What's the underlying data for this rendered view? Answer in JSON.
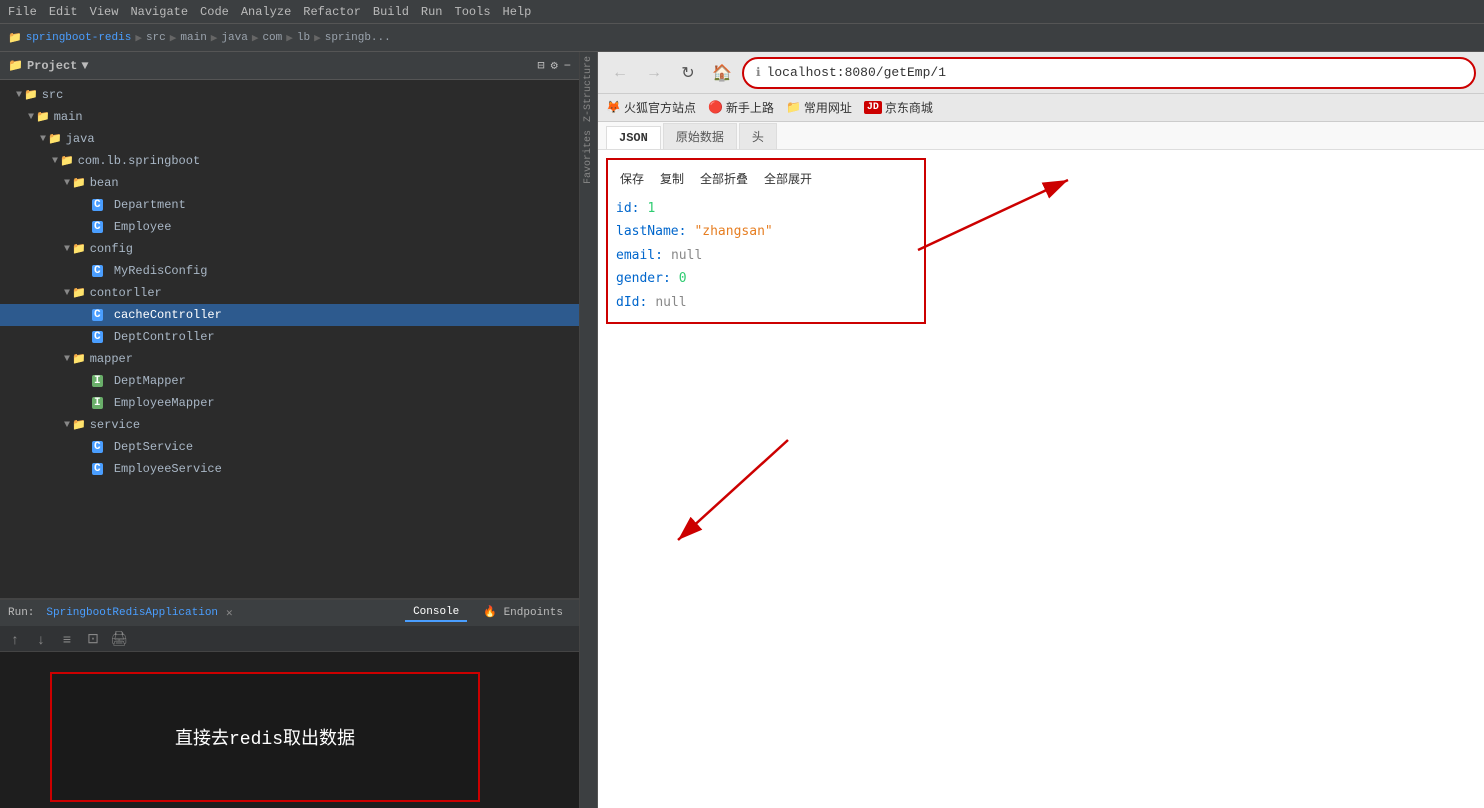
{
  "menubar": {
    "items": [
      "File",
      "Edit",
      "View",
      "Navigate",
      "Code",
      "Analyze",
      "Refactor",
      "Build",
      "Run",
      "Tools",
      "Help"
    ]
  },
  "toolbar": {
    "project_name": "springboot-redis",
    "breadcrumb": [
      "src",
      "main",
      "java",
      "com",
      "lb",
      "springb..."
    ]
  },
  "project_panel": {
    "title": "Project",
    "root": "src",
    "tree": [
      {
        "label": "src",
        "type": "folder",
        "indent": 0,
        "expanded": true
      },
      {
        "label": "main",
        "type": "folder",
        "indent": 1,
        "expanded": true
      },
      {
        "label": "java",
        "type": "folder",
        "indent": 2,
        "expanded": true
      },
      {
        "label": "com.lb.springboot",
        "type": "folder",
        "indent": 3,
        "expanded": true
      },
      {
        "label": "bean",
        "type": "folder",
        "indent": 4,
        "expanded": true
      },
      {
        "label": "Department",
        "type": "class",
        "indent": 5
      },
      {
        "label": "Employee",
        "type": "class",
        "indent": 5
      },
      {
        "label": "config",
        "type": "folder",
        "indent": 4,
        "expanded": true
      },
      {
        "label": "MyRedisConfig",
        "type": "class",
        "indent": 5
      },
      {
        "label": "contorller",
        "type": "folder",
        "indent": 4,
        "expanded": true
      },
      {
        "label": "cacheController",
        "type": "class",
        "indent": 5,
        "selected": true
      },
      {
        "label": "DeptController",
        "type": "class",
        "indent": 5
      },
      {
        "label": "mapper",
        "type": "folder",
        "indent": 4,
        "expanded": true
      },
      {
        "label": "DeptMapper",
        "type": "interface",
        "indent": 5
      },
      {
        "label": "EmployeeMapper",
        "type": "interface",
        "indent": 5
      },
      {
        "label": "service",
        "type": "folder",
        "indent": 4,
        "expanded": true
      },
      {
        "label": "DeptService",
        "type": "class",
        "indent": 5
      },
      {
        "label": "EmployeeService",
        "type": "class",
        "indent": 5
      }
    ]
  },
  "run_panel": {
    "run_label": "Run:",
    "app_name": "SpringbootRedisApplication",
    "tabs": [
      "Console",
      "Endpoints"
    ],
    "console_message": "直接去redis取出数据"
  },
  "browser": {
    "url": "localhost:8080/getEmp/1",
    "bookmarks": [
      {
        "label": "火狐官方站点",
        "icon": "🦊"
      },
      {
        "label": "新手上路",
        "icon": "🔴"
      },
      {
        "label": "常用网址",
        "icon": "📁"
      },
      {
        "label": "京东商城",
        "icon": "JD"
      }
    ],
    "tabs": [
      "JSON",
      "原始数据",
      "头"
    ],
    "json_toolbar": [
      "保存",
      "复制",
      "全部折叠",
      "全部展开"
    ],
    "json_data": {
      "id_key": "id:",
      "id_val": "1",
      "lastName_key": "lastName:",
      "lastName_val": "\"zhangsan\"",
      "email_key": "email:",
      "email_val": "null",
      "gender_key": "gender:",
      "gender_val": "0",
      "dId_key": "dId:",
      "dId_val": "null"
    }
  },
  "annotations": {
    "arrow1_label": "直接去redis取出数据"
  }
}
